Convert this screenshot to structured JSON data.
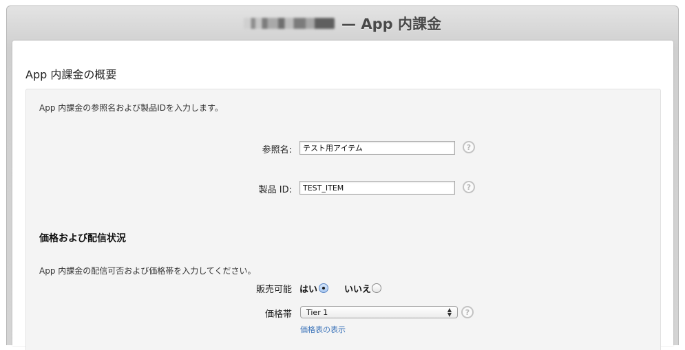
{
  "window": {
    "title_suffix": "— App 内課金"
  },
  "page": {
    "title": "App 内課金の概要"
  },
  "overview": {
    "description": "App 内課金の参照名および製品IDを入力します。",
    "reference_name": {
      "label": "参照名:",
      "value": "テスト用アイテム"
    },
    "product_id": {
      "label": "製品 ID:",
      "value": "TEST_ITEM"
    },
    "help_symbol": "?"
  },
  "pricing": {
    "heading": "価格および配信状況",
    "description": "App 内課金の配信可否および価格帯を入力してください。",
    "cleared_for_sale": {
      "label": "販売可能",
      "yes_label": "はい",
      "no_label": "いいえ",
      "selected": "yes"
    },
    "price_tier": {
      "label": "価格帯",
      "selected": "Tier 1"
    },
    "price_matrix_link": "価格表の表示",
    "help_symbol": "?"
  },
  "colors": {
    "link": "#3b73b9",
    "radio_selected": "#a9c8f0"
  }
}
